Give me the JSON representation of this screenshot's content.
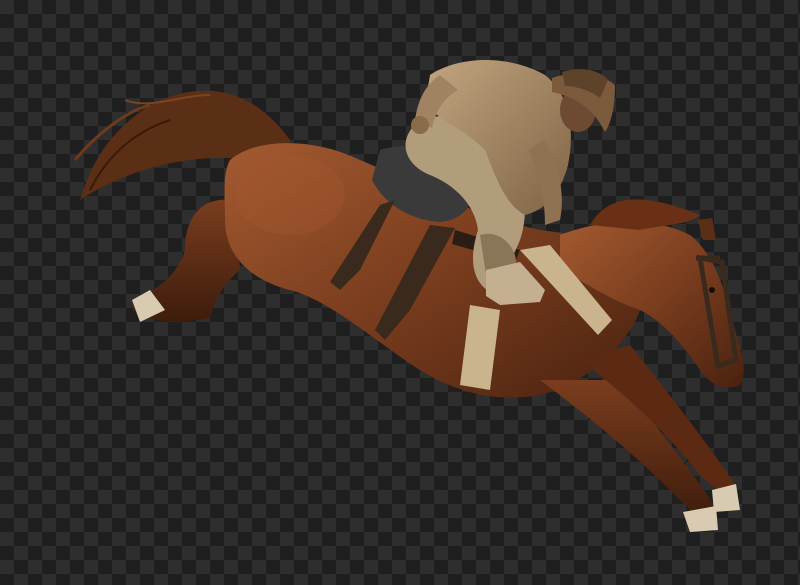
{
  "image": {
    "background": "transparency-checkerboard",
    "subject": "bucking-horse-with-rider",
    "colors": {
      "checker_dark": "#1f1f1f",
      "checker_light": "#2e2e2e",
      "horse_coat": "#7a3d1e",
      "horse_shadow": "#4a2210",
      "horse_highlight": "#a35a30",
      "mane_tail": "#5b2e16",
      "rider_jacket": "#a08462",
      "rider_chaps": "#b19c7c",
      "hat": "#7c5a3c",
      "tack_leather": "#3a2a1e",
      "cinch_strap": "#c9b48e"
    }
  }
}
